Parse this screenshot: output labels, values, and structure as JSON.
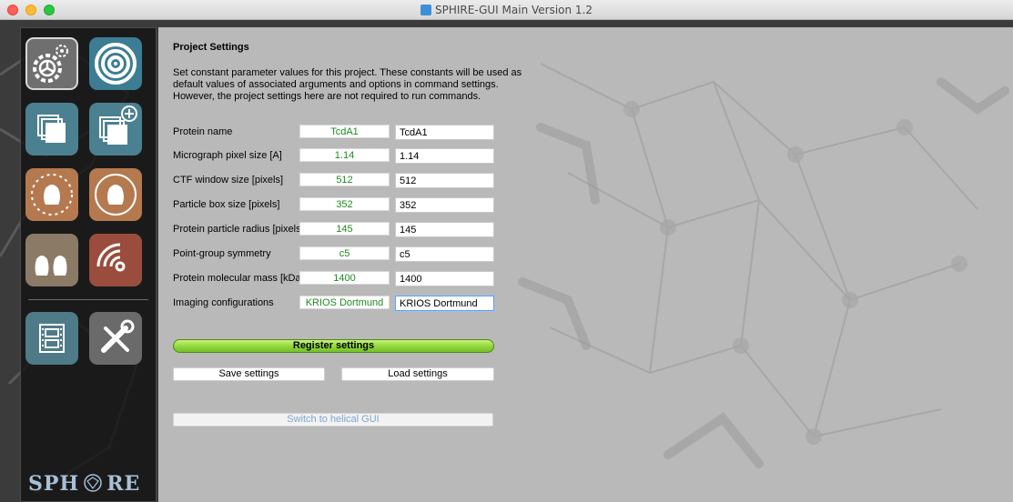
{
  "window": {
    "title": "SPHIRE-GUI Main Version 1.2"
  },
  "sidebar": {
    "buttons": [
      {
        "name": "project-settings",
        "icon": "settings-gears-icon",
        "color": "#6f6f6f"
      },
      {
        "name": "movie-target",
        "icon": "target-rings-icon",
        "color": "#3d7d94"
      },
      {
        "name": "micrographs",
        "icon": "stacked-images-icon",
        "color": "#4b8090"
      },
      {
        "name": "micrographs-add",
        "icon": "stacked-images-add-icon",
        "color": "#4b8090"
      },
      {
        "name": "particle-picking",
        "icon": "particle-burst-icon",
        "color": "#b5794f"
      },
      {
        "name": "particle-refine",
        "icon": "particle-circle-icon",
        "color": "#b5794f"
      },
      {
        "name": "heterogeneity",
        "icon": "particle-pair-icon",
        "color": "#8a7a66"
      },
      {
        "name": "local-resolution",
        "icon": "resolution-waves-icon",
        "color": "#9a4d3c"
      },
      {
        "name": "movie-utilities",
        "icon": "film-strip-icon",
        "color": "#4f7a88"
      },
      {
        "name": "utilities",
        "icon": "tools-icon",
        "color": "#6a6a6a"
      }
    ],
    "logo_text_left": "SPH",
    "logo_text_right": "RE"
  },
  "project": {
    "title": "Project Settings",
    "description": [
      "Set constant parameter values for this project. These constants will be used as",
      "default values of associated arguments and options in command settings.",
      "However, the project settings here are not required to run commands."
    ],
    "rows": [
      {
        "label": "Protein name",
        "default": "TcdA1",
        "value": "TcdA1"
      },
      {
        "label": "Micrograph pixel size [A]",
        "default": "1.14",
        "value": "1.14"
      },
      {
        "label": "CTF window size [pixels]",
        "default": "512",
        "value": "512"
      },
      {
        "label": "Particle box size [pixels]",
        "default": "352",
        "value": "352"
      },
      {
        "label": "Protein particle radius [pixels]",
        "default": "145",
        "value": "145"
      },
      {
        "label": "Point-group symmetry",
        "default": "c5",
        "value": "c5"
      },
      {
        "label": "Protein molecular mass [kDa]",
        "default": "1400",
        "value": "1400"
      },
      {
        "label": "Imaging configurations",
        "default": "KRIOS Dortmund",
        "value": "KRIOS Dortmund"
      }
    ],
    "register_label": "Register settings",
    "save_label": "Save settings",
    "load_label": "Load settings",
    "helical_label": "Switch to helical GUI"
  },
  "colors": {
    "default_value_text": "#1e8a1e",
    "register_button": "#8fd63a",
    "helical_link": "#7aa6d4"
  }
}
